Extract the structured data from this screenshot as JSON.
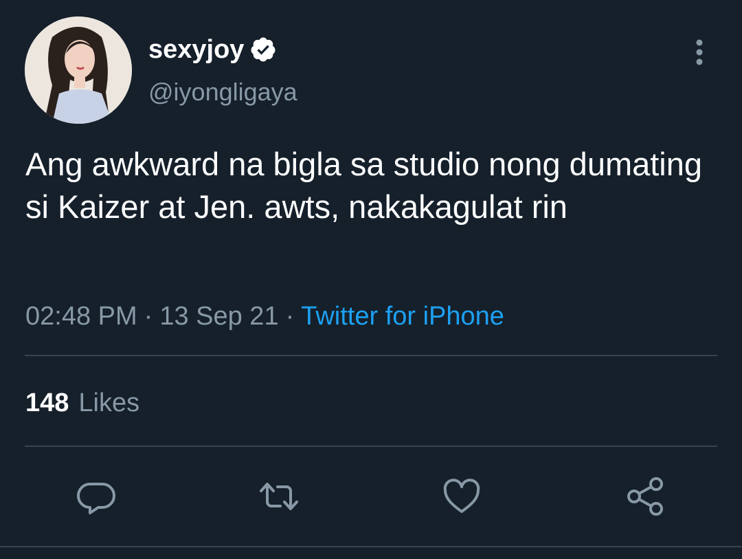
{
  "tweet": {
    "author": {
      "display_name": "sexyjoy",
      "handle": "@iyongligaya",
      "verified": true
    },
    "text": "Ang awkward na bigla sa studio nong dumating si Kaizer at Jen. awts, nakakagulat rin",
    "time": "02:48 PM",
    "date": "13 Sep 21",
    "separator": "·",
    "source": "Twitter for iPhone",
    "likes": {
      "count": "148",
      "label": "Likes"
    }
  },
  "icons": {
    "more": "more-vertical-icon",
    "reply": "reply-icon",
    "retweet": "retweet-icon",
    "like": "heart-icon",
    "share": "share-icon"
  },
  "colors": {
    "background": "#15202b",
    "secondary_text": "#8899a6",
    "link": "#1da1f2",
    "divider": "#38444d"
  }
}
